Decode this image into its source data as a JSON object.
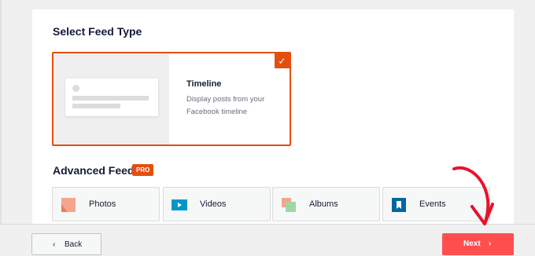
{
  "section_title": "Select Feed Type",
  "timeline": {
    "title": "Timeline",
    "description": "Display posts from your Facebook timeline",
    "selected": true,
    "check_icon": "check-icon"
  },
  "advanced": {
    "title": "Advanced Feeds",
    "badge": "PRO",
    "options": [
      {
        "label": "Photos",
        "icon": "photos-icon"
      },
      {
        "label": "Videos",
        "icon": "videos-icon"
      },
      {
        "label": "Albums",
        "icon": "albums-icon"
      },
      {
        "label": "Events",
        "icon": "events-icon"
      }
    ]
  },
  "footer": {
    "back_label": "Back",
    "next_label": "Next"
  },
  "colors": {
    "accent": "#e34f0e",
    "next_button": "#ff4e4e",
    "annotation_arrow": "#e8122b"
  }
}
